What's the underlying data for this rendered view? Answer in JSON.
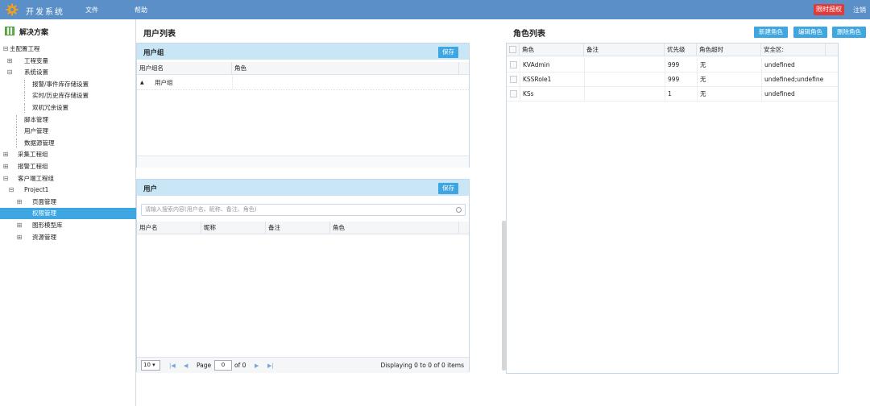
{
  "topbar": {
    "brand": "开发系统",
    "menu": [
      "文件",
      "帮助"
    ],
    "license_button": "限时授权",
    "logout": "注销"
  },
  "sidebar": {
    "title": "解决方案",
    "tree": [
      {
        "label": "主配置工程",
        "toggle": "⊟"
      },
      {
        "label": "工程变量",
        "toggle": "⊞"
      },
      {
        "label": "系统设置",
        "toggle": "⊟"
      },
      {
        "label": "报警/事件库存储设置",
        "toggle": ""
      },
      {
        "label": "实时/历史库存储设置",
        "toggle": ""
      },
      {
        "label": "双机冗余设置",
        "toggle": ""
      },
      {
        "label": "脚本管理",
        "toggle": ""
      },
      {
        "label": "用户管理",
        "toggle": ""
      },
      {
        "label": "数据源管理",
        "toggle": ""
      },
      {
        "label": "采集工程组",
        "toggle": "⊞"
      },
      {
        "label": "报警工程组",
        "toggle": "⊞"
      },
      {
        "label": "客户端工程组",
        "toggle": "⊟"
      },
      {
        "label": "Project1",
        "toggle": "⊟"
      },
      {
        "label": "页面管理",
        "toggle": "⊞"
      },
      {
        "label": "权限管理",
        "toggle": ""
      },
      {
        "label": "图形模型库",
        "toggle": "⊞"
      },
      {
        "label": "资源管理",
        "toggle": "⊞"
      }
    ]
  },
  "user_list": {
    "title": "用户列表",
    "group_panel": {
      "title": "用户组",
      "save": "保存",
      "columns": [
        "用户组名",
        "角色"
      ],
      "rows": [
        {
          "name": "用户组",
          "role": ""
        }
      ],
      "expand_glyph": "▲"
    },
    "user_panel": {
      "title": "用户",
      "save": "保存",
      "search_placeholder": "请输入搜索内容(用户名、昵称、备注、角色)",
      "columns": [
        "用户名",
        "昵称",
        "备注",
        "角色"
      ],
      "pager": {
        "page_size": "10",
        "page_label": "Page",
        "page_value": "0",
        "of_label": "of 0",
        "summary": "Displaying 0 to 0 of 0 items"
      }
    }
  },
  "role_list": {
    "title": "角色列表",
    "buttons": [
      "新建角色",
      "编辑角色",
      "删除角色"
    ],
    "columns": [
      "角色",
      "备注",
      "优先级",
      "角色超时",
      "安全区:"
    ],
    "rows": [
      {
        "role": "KVAdmin",
        "note": "",
        "priority": "999",
        "timeout": "无",
        "zone": "undefined"
      },
      {
        "role": "KSSRole1",
        "note": "",
        "priority": "999",
        "timeout": "无",
        "zone": "undefined;undefine"
      },
      {
        "role": "KSs",
        "note": "",
        "priority": "1",
        "timeout": "无",
        "zone": "undefined"
      }
    ]
  },
  "colors": {
    "topbar": "#5a8fc8",
    "accent": "#3ea6e0",
    "panel_header": "#c9e6f7",
    "license": "#e03b3b"
  }
}
